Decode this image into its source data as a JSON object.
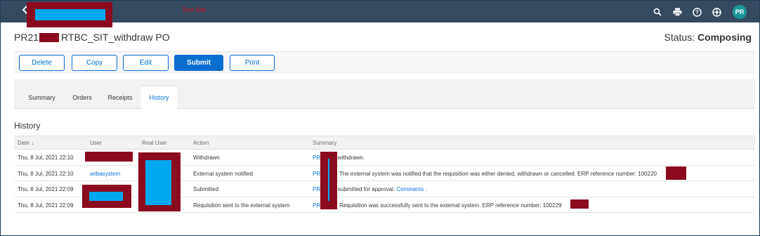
{
  "header": {
    "env_text": "Test Site"
  },
  "title": {
    "prefix": "PR21",
    "suffix": "RTBC_SIT_withdraw PO"
  },
  "status": {
    "label": "Status:",
    "value": "Composing"
  },
  "toolbar": {
    "delete": "Delete",
    "copy": "Copy",
    "edit": "Edit",
    "submit": "Submit",
    "print": "Print"
  },
  "tabs": [
    {
      "label": "Summary"
    },
    {
      "label": "Orders"
    },
    {
      "label": "Receipts"
    },
    {
      "label": "History"
    }
  ],
  "history": {
    "title": "History",
    "columns": {
      "date": "Date",
      "sort_icon": "↓",
      "user": "User",
      "real_user": "Real User",
      "action": "Action",
      "summary": "Summary"
    },
    "rows": [
      {
        "date": "Thu, 8 Jul, 2021 22:10",
        "user": "",
        "action": "Withdrawn",
        "summary_link": "PR2",
        "summary": " withdrawn.",
        "comments": ""
      },
      {
        "date": "Thu, 8 Jul, 2021 22:10",
        "user": "aribasystem",
        "action": "External system notified",
        "summary_link": "PR2",
        "summary": ": The external system was notified that the requisition was either denied, withdrawn or cancelled. ERP reference number: 100220",
        "comments": ""
      },
      {
        "date": "Thu, 8 Jul, 2021 22:09",
        "user": "",
        "action": "Submitted",
        "summary_link": "PR2",
        "summary": " submitted for approval.",
        "comments": "Comments",
        "trail": " ."
      },
      {
        "date": "Thu, 8 Jul, 2021 22:09",
        "user": "",
        "action": "Requisition sent to the external system",
        "summary_link": "PR2",
        "summary": ": Requisition was successfully sent to the external system. ERP reference number: 100229",
        "comments": ""
      }
    ]
  },
  "colors": {
    "shell": "#354a5f",
    "accent": "#0a6ed1",
    "redaction": "#8a0b1f",
    "redaction_fill": "#00a8f0",
    "avatar": "#1a9898"
  },
  "icons": [
    "back-icon",
    "search-icon",
    "print-icon",
    "help-icon",
    "settings-icon"
  ],
  "avatar": "PR"
}
